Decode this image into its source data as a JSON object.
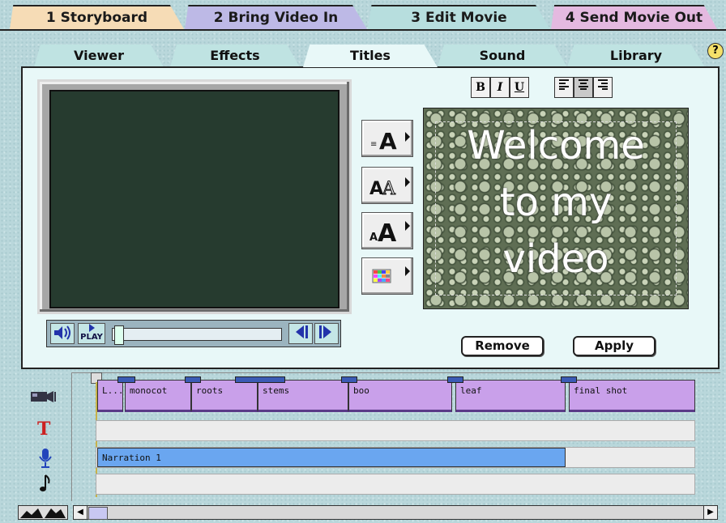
{
  "top_tabs": [
    "1 Storyboard",
    "2 Bring Video In",
    "3 Edit Movie",
    "4 Send Movie Out"
  ],
  "sub_tabs": [
    "Viewer",
    "Effects",
    "Titles",
    "Sound",
    "Library"
  ],
  "help_label": "?",
  "format_buttons": {
    "bold": "B",
    "italic": "I",
    "underline": "U"
  },
  "player": {
    "play_label": "PLAY"
  },
  "title_preview": {
    "line1": "Welcome",
    "line2": "to my",
    "line3": "video"
  },
  "actions": {
    "remove": "Remove",
    "apply": "Apply"
  },
  "video_clips": [
    "L...",
    "monocot",
    "roots",
    "stems",
    "boo",
    "leaf",
    "final shot"
  ],
  "narration_clip": "Narration 1",
  "track_icons": [
    "camera-icon",
    "title-icon",
    "microphone-icon",
    "music-note-icon"
  ],
  "colors": {
    "active_tab": "#e8f8f8",
    "clip": "#c9a0ea",
    "narration": "#6aa6f0",
    "screen": "#263b2f"
  }
}
